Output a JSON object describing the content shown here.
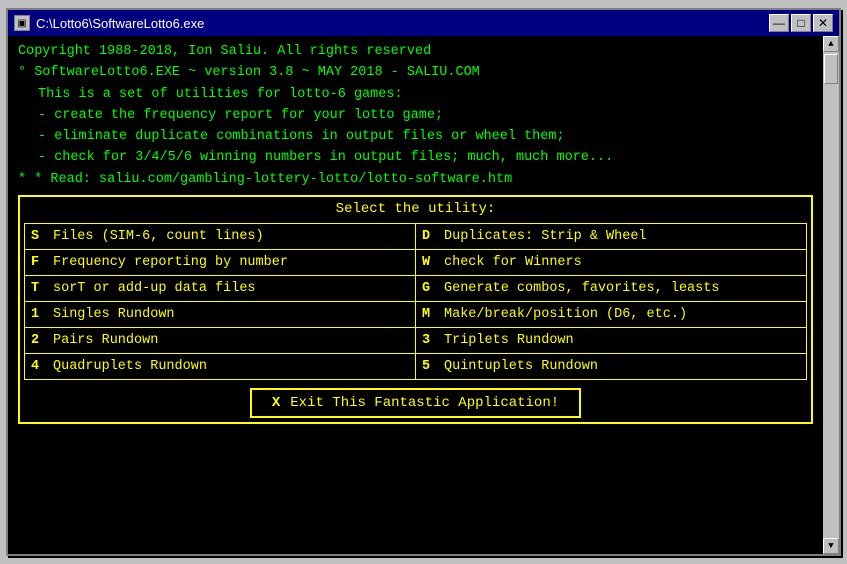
{
  "window": {
    "title": "C:\\Lotto6\\SoftwareLotto6.exe",
    "controls": {
      "minimize": "—",
      "maximize": "□",
      "close": "✕"
    }
  },
  "header": {
    "line1": "Copyright 1988-2018, Ion Saliu. All rights reserved",
    "line2": "SoftwareLotto6.EXE ~ version 3.8 ~ MAY 2018 - SALIU.COM",
    "line3": "This is a set of utilities for lotto-6 games:",
    "line4": "- create the frequency report for your lotto game;",
    "line5": "- eliminate duplicate combinations in output files or wheel them;",
    "line6": "- check for 3/4/5/6 winning numbers in output files; much, much more...",
    "line7": "* Read: saliu.com/gambling-lottery-lotto/lotto-software.htm"
  },
  "menu": {
    "title": "Select the utility:",
    "items": [
      {
        "key": "S",
        "label": "Files (SIM-6, count lines)",
        "side": "left"
      },
      {
        "key": "D",
        "label": "Duplicates: Strip & Wheel",
        "side": "right"
      },
      {
        "key": "F",
        "label": "Frequency reporting by number",
        "side": "left"
      },
      {
        "key": "W",
        "label": "check for Winners",
        "side": "right"
      },
      {
        "key": "T",
        "label": "sorT or add-up data files",
        "side": "left"
      },
      {
        "key": "G",
        "label": "Generate combos, favorites, leasts",
        "side": "right"
      },
      {
        "key": "1",
        "label": "Singles Rundown",
        "side": "left"
      },
      {
        "key": "M",
        "label": "Make/break/position (D6, etc.)",
        "side": "right"
      },
      {
        "key": "2",
        "label": "Pairs Rundown",
        "side": "left"
      },
      {
        "key": "3",
        "label": "Triplets Rundown",
        "side": "right"
      },
      {
        "key": "4",
        "label": "Quadruplets Rundown",
        "side": "left"
      },
      {
        "key": "5",
        "label": "Quintuplets Rundown",
        "side": "right"
      }
    ],
    "exit": {
      "key": "X",
      "label": "Exit This Fantastic Application!"
    }
  }
}
